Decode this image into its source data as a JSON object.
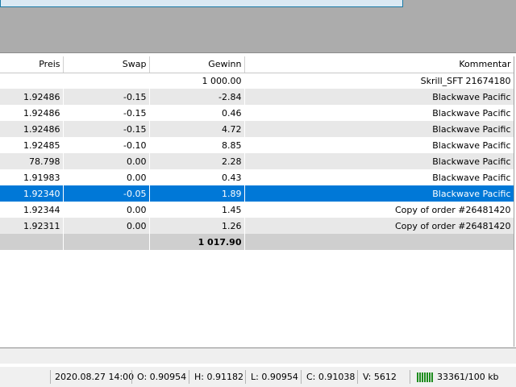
{
  "table": {
    "columns": [
      "Preis",
      "Swap",
      "Gewinn",
      "Kommentar"
    ],
    "rows": [
      {
        "preis": "",
        "swap": "",
        "gewinn": "1 000.00",
        "kommentar": "Skrill_SFT 21674180",
        "style": "plain"
      },
      {
        "preis": "1.92486",
        "swap": "-0.15",
        "gewinn": "-2.84",
        "kommentar": "Blackwave Pacific",
        "style": "alt"
      },
      {
        "preis": "1.92486",
        "swap": "-0.15",
        "gewinn": "0.46",
        "kommentar": "Blackwave Pacific",
        "style": "plain"
      },
      {
        "preis": "1.92486",
        "swap": "-0.15",
        "gewinn": "4.72",
        "kommentar": "Blackwave Pacific",
        "style": "alt"
      },
      {
        "preis": "1.92485",
        "swap": "-0.10",
        "gewinn": "8.85",
        "kommentar": "Blackwave Pacific",
        "style": "plain"
      },
      {
        "preis": "78.798",
        "swap": "0.00",
        "gewinn": "2.28",
        "kommentar": "Blackwave Pacific",
        "style": "alt"
      },
      {
        "preis": "1.91983",
        "swap": "0.00",
        "gewinn": "0.43",
        "kommentar": "Blackwave Pacific",
        "style": "plain"
      },
      {
        "preis": "1.92340",
        "swap": "-0.05",
        "gewinn": "1.89",
        "kommentar": "Blackwave Pacific",
        "style": "sel"
      },
      {
        "preis": "1.92344",
        "swap": "0.00",
        "gewinn": "1.45",
        "kommentar": "Copy of order #26481420",
        "style": "plain"
      },
      {
        "preis": "1.92311",
        "swap": "0.00",
        "gewinn": "1.26",
        "kommentar": "Copy of order #26481420",
        "style": "alt"
      }
    ],
    "total": {
      "preis": "",
      "swap": "",
      "gewinn": "1 017.90",
      "kommentar": ""
    }
  },
  "status": {
    "datetime": "2020.08.27 14:00",
    "open": "O: 0.90954",
    "high": "H: 0.91182",
    "low": "L: 0.90954",
    "close": "C: 0.91038",
    "volume": "V: 5612",
    "traffic": "33361/100 kb",
    "traffic_icon": "signal-bars-icon"
  },
  "colors": {
    "selection": "#0078d7",
    "alt_row": "#e8e8e8",
    "total_row": "#cfcfcf",
    "top_area": "#acacac",
    "signal": "#1e8c1e"
  }
}
